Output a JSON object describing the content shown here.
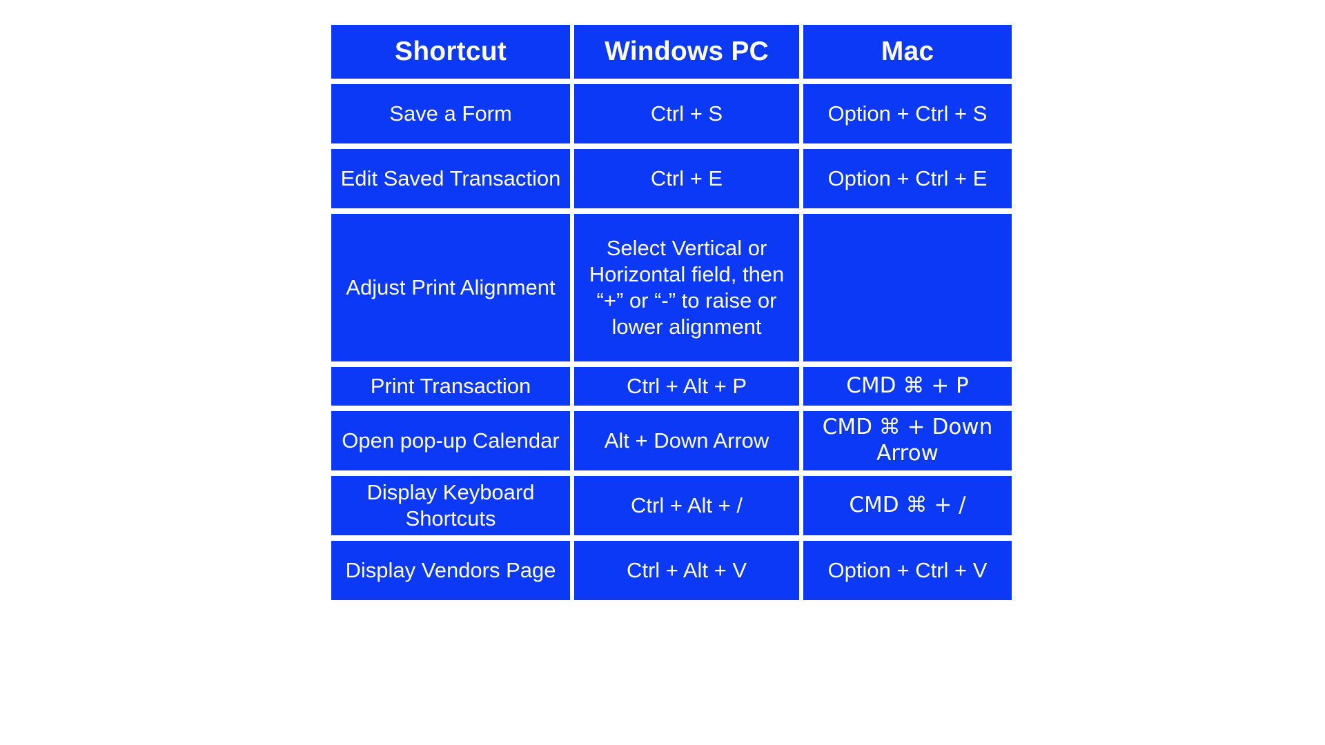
{
  "theme": {
    "cell_blue": "#0b39f5",
    "text_color": "#ffffff",
    "page_background": "#ffffff"
  },
  "table": {
    "columns": [
      "Shortcut",
      "Windows PC",
      "Mac"
    ],
    "rows": [
      {
        "shortcut": "Save a Form",
        "windows": "Ctrl + S",
        "mac": "Option + Ctrl + S"
      },
      {
        "shortcut": "Edit Saved Transaction",
        "windows": "Ctrl + E",
        "mac": "Option + Ctrl + E"
      },
      {
        "shortcut": "Adjust Print Alignment",
        "windows": "Select Vertical or Horizontal field, then “+” or “-” to raise or lower alignment",
        "mac": ""
      },
      {
        "shortcut": "Print Transaction",
        "windows": "Ctrl + Alt + P",
        "mac": "CMD ⌘ + P"
      },
      {
        "shortcut": "Open pop-up Calendar",
        "windows": "Alt + Down Arrow",
        "mac": "CMD ⌘ +  Down Arrow"
      },
      {
        "shortcut": "Display Keyboard Shortcuts",
        "windows": "Ctrl + Alt + /",
        "mac": "CMD ⌘ + /"
      },
      {
        "shortcut": "Display Vendors Page",
        "windows": "Ctrl + Alt + V",
        "mac": "Option + Ctrl + V"
      }
    ]
  }
}
